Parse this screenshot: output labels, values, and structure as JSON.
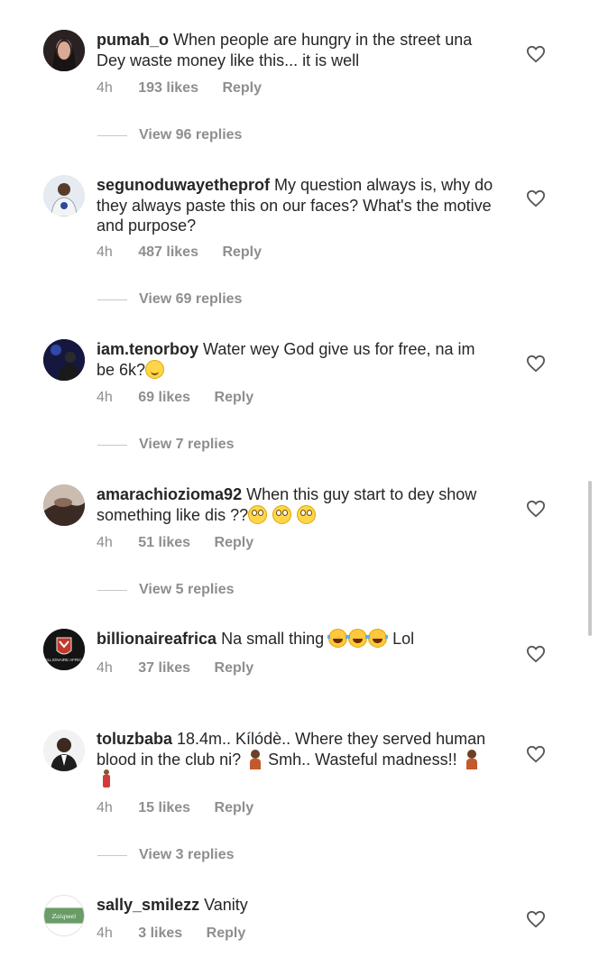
{
  "comments": [
    {
      "username": "pumah_o",
      "text": "When people are hungry in the street una Dey waste money like this... it is well",
      "time": "4h",
      "likes": "193 likes",
      "reply": "Reply",
      "view_replies": "View 96 replies",
      "avatar_icon": "profile-photo-woman"
    },
    {
      "username": "segunoduwayetheprof",
      "text": "My question always is, why do they always paste this on our faces? What's the motive and purpose?",
      "time": "4h",
      "likes": "487 likes",
      "reply": "Reply",
      "view_replies": "View 69 replies",
      "avatar_icon": "profile-photo-man"
    },
    {
      "username": "iam.tenorboy",
      "text": "Water wey God give us for free, na im be 6k?",
      "time": "4h",
      "likes": "69 likes",
      "reply": "Reply",
      "view_replies": "View 7 replies",
      "avatar_icon": "profile-photo-performer"
    },
    {
      "username": "amarachiozioma92",
      "text": "When this guy start to dey show something like dis ??",
      "time": "4h",
      "likes": "51 likes",
      "reply": "Reply",
      "view_replies": "View 5 replies",
      "avatar_icon": "profile-photo-hand"
    },
    {
      "username": "billionaireafrica",
      "text": "Na small thing",
      "text_suffix": "Lol",
      "time": "4h",
      "likes": "37 likes",
      "reply": "Reply",
      "avatar_icon": "billionaire-africa-logo",
      "logo_text": "BILLIONAIRE AFRICA"
    },
    {
      "username": "toluzbaba",
      "text": "18.4m.. Kílódè.. Where they served human blood in the club ni?",
      "text_mid": "Smh.. Wasteful madness!!",
      "time": "4h",
      "likes": "15 likes",
      "reply": "Reply",
      "view_replies": "View 3 replies",
      "avatar_icon": "profile-photo-suit"
    },
    {
      "username": "sally_smilezz",
      "text": "Vanity",
      "time": "4h",
      "likes": "3 likes",
      "reply": "Reply",
      "avatar_icon": "profile-photo-green",
      "logo_text": "Zaiqwei"
    }
  ],
  "colors": {
    "text": "#262626",
    "meta": "#8e8e8e",
    "divider": "#c7c7c7"
  }
}
